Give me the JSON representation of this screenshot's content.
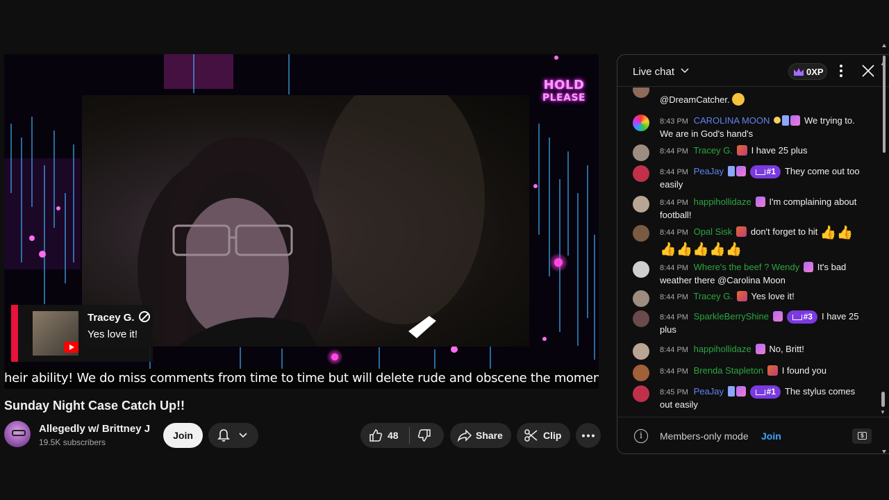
{
  "player": {
    "hold_line1": "HOLD",
    "hold_line2": "PLEASE",
    "overlay": {
      "name": "Tracey G.",
      "message": "Yes love it!"
    },
    "ticker": "heir ability! We do miss comments from time to time but will delete rude and obscene the moment we ar"
  },
  "video": {
    "title": "Sunday Night Case Catch Up!!",
    "channel": "Allegedly w/ Brittney J",
    "subscribers": "19.5K subscribers",
    "join_label": "Join",
    "likes": "48",
    "share_label": "Share",
    "clip_label": "Clip",
    "icons": [
      "bell-icon",
      "chevron-down-icon",
      "like-icon",
      "dislike-icon",
      "share-icon",
      "scissors-icon",
      "more-icon"
    ]
  },
  "chat": {
    "title": "Live chat",
    "xp": "0XP",
    "messages": [
      {
        "time": "",
        "author": "",
        "author_color": "green",
        "text": "@DreamCatcher."
      },
      {
        "time": "8:43 PM",
        "author": "CAROLINA MOON",
        "author_color": "blue",
        "text": "We trying to. We are in God's hand's"
      },
      {
        "time": "8:44 PM",
        "author": "Tracey G.",
        "author_color": "green",
        "text": "I have 25 plus"
      },
      {
        "time": "8:44 PM",
        "author": "PeaJay",
        "author_color": "blue",
        "rank": "#1",
        "text": "They come out too easily"
      },
      {
        "time": "8:44 PM",
        "author": "happihollidaze",
        "author_color": "green",
        "text": "I'm complaining about football!"
      },
      {
        "time": "8:44 PM",
        "author": "Opal Sisk",
        "author_color": "green",
        "text": "don't forget to hit"
      },
      {
        "time": "8:44 PM",
        "author": "Where's the beef ? Wendy",
        "author_color": "green",
        "text": "It's bad weather there @Carolina Moon"
      },
      {
        "time": "8:44 PM",
        "author": "Tracey G.",
        "author_color": "green",
        "text": "Yes love it!"
      },
      {
        "time": "8:44 PM",
        "author": "SparkleBerryShine",
        "author_color": "green",
        "rank": "#3",
        "text": "I have 25 plus"
      },
      {
        "time": "8:44 PM",
        "author": "happihollidaze",
        "author_color": "green",
        "text": "No, Britt!"
      },
      {
        "time": "8:44 PM",
        "author": "Brenda Stapleton",
        "author_color": "green",
        "text": "I found you"
      },
      {
        "time": "8:45 PM",
        "author": "PeaJay",
        "author_color": "blue",
        "rank": "#1",
        "text": "The stylus comes out easily"
      }
    ],
    "footer_mode": "Members-only mode",
    "footer_join": "Join",
    "accent_green": "#2ba640",
    "accent_blue": "#5e84f1",
    "rank_purple": "#7a3ae0"
  }
}
